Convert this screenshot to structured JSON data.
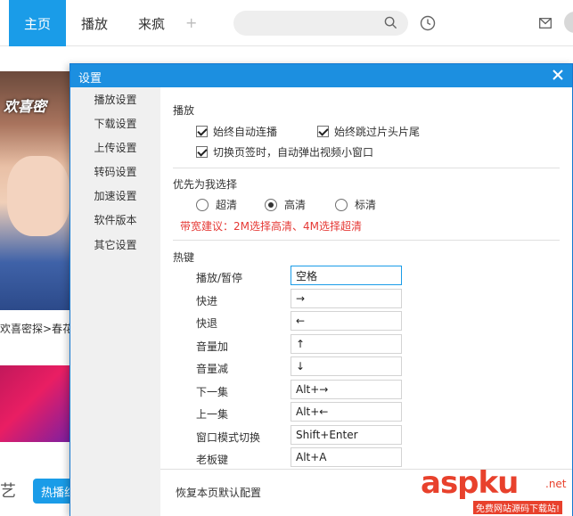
{
  "app": {
    "tabs": [
      "主页",
      "播放",
      "来疯"
    ],
    "plus": "+",
    "search_placeholder": "",
    "poster_title": "欢喜密",
    "caption": "欢喜密探>春花",
    "bottom_text": "艺",
    "hot_button": "热播综"
  },
  "dialog": {
    "title": "设置",
    "sidebar": [
      "播放设置",
      "下载设置",
      "上传设置",
      "转码设置",
      "加速设置",
      "软件版本",
      "其它设置"
    ],
    "play": {
      "title": "播放",
      "options": [
        "始终自动连播",
        "始终跳过片头片尾",
        "切换页签时，自动弹出视频小窗口"
      ]
    },
    "quality": {
      "title": "优先为我选择",
      "options": [
        "超清",
        "高清",
        "标清"
      ],
      "selected": "高清",
      "tip": "带宽建议：2M选择高清、4M选择超清"
    },
    "hotkeys": {
      "title": "热键",
      "items": [
        {
          "label": "播放/暂停",
          "key": "空格"
        },
        {
          "label": "快进",
          "key": "→"
        },
        {
          "label": "快退",
          "key": "←"
        },
        {
          "label": "音量加",
          "key": "↑"
        },
        {
          "label": "音量减",
          "key": "↓"
        },
        {
          "label": "下一集",
          "key": "Alt+→"
        },
        {
          "label": "上一集",
          "key": "Alt+←"
        },
        {
          "label": "窗口模式切换",
          "key": "Shift+Enter"
        },
        {
          "label": "老板键",
          "key": "Alt+A"
        }
      ]
    },
    "footer_link": "恢复本页默认配置"
  },
  "watermark": {
    "brand": "aspku",
    "net": ".net",
    "sub": "免费网站源码下载站!"
  },
  "colors": {
    "accent": "#1a9ce8",
    "tip": "#e53935",
    "watermark": "#e8412c"
  }
}
